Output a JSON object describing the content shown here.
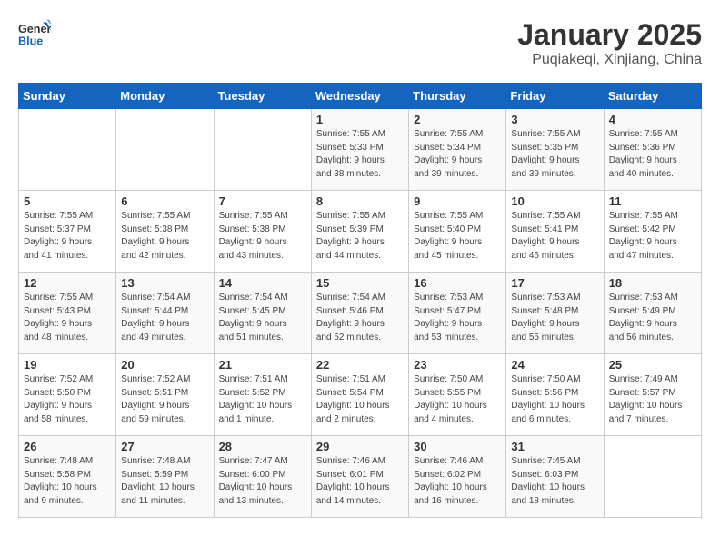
{
  "header": {
    "logo_line1": "General",
    "logo_line2": "Blue",
    "title": "January 2025",
    "subtitle": "Puqiakeqi, Xinjiang, China"
  },
  "days_of_week": [
    "Sunday",
    "Monday",
    "Tuesday",
    "Wednesday",
    "Thursday",
    "Friday",
    "Saturday"
  ],
  "weeks": [
    [
      {
        "day": "",
        "info": ""
      },
      {
        "day": "",
        "info": ""
      },
      {
        "day": "",
        "info": ""
      },
      {
        "day": "1",
        "info": "Sunrise: 7:55 AM\nSunset: 5:33 PM\nDaylight: 9 hours\nand 38 minutes."
      },
      {
        "day": "2",
        "info": "Sunrise: 7:55 AM\nSunset: 5:34 PM\nDaylight: 9 hours\nand 39 minutes."
      },
      {
        "day": "3",
        "info": "Sunrise: 7:55 AM\nSunset: 5:35 PM\nDaylight: 9 hours\nand 39 minutes."
      },
      {
        "day": "4",
        "info": "Sunrise: 7:55 AM\nSunset: 5:36 PM\nDaylight: 9 hours\nand 40 minutes."
      }
    ],
    [
      {
        "day": "5",
        "info": "Sunrise: 7:55 AM\nSunset: 5:37 PM\nDaylight: 9 hours\nand 41 minutes."
      },
      {
        "day": "6",
        "info": "Sunrise: 7:55 AM\nSunset: 5:38 PM\nDaylight: 9 hours\nand 42 minutes."
      },
      {
        "day": "7",
        "info": "Sunrise: 7:55 AM\nSunset: 5:38 PM\nDaylight: 9 hours\nand 43 minutes."
      },
      {
        "day": "8",
        "info": "Sunrise: 7:55 AM\nSunset: 5:39 PM\nDaylight: 9 hours\nand 44 minutes."
      },
      {
        "day": "9",
        "info": "Sunrise: 7:55 AM\nSunset: 5:40 PM\nDaylight: 9 hours\nand 45 minutes."
      },
      {
        "day": "10",
        "info": "Sunrise: 7:55 AM\nSunset: 5:41 PM\nDaylight: 9 hours\nand 46 minutes."
      },
      {
        "day": "11",
        "info": "Sunrise: 7:55 AM\nSunset: 5:42 PM\nDaylight: 9 hours\nand 47 minutes."
      }
    ],
    [
      {
        "day": "12",
        "info": "Sunrise: 7:55 AM\nSunset: 5:43 PM\nDaylight: 9 hours\nand 48 minutes."
      },
      {
        "day": "13",
        "info": "Sunrise: 7:54 AM\nSunset: 5:44 PM\nDaylight: 9 hours\nand 49 minutes."
      },
      {
        "day": "14",
        "info": "Sunrise: 7:54 AM\nSunset: 5:45 PM\nDaylight: 9 hours\nand 51 minutes."
      },
      {
        "day": "15",
        "info": "Sunrise: 7:54 AM\nSunset: 5:46 PM\nDaylight: 9 hours\nand 52 minutes."
      },
      {
        "day": "16",
        "info": "Sunrise: 7:53 AM\nSunset: 5:47 PM\nDaylight: 9 hours\nand 53 minutes."
      },
      {
        "day": "17",
        "info": "Sunrise: 7:53 AM\nSunset: 5:48 PM\nDaylight: 9 hours\nand 55 minutes."
      },
      {
        "day": "18",
        "info": "Sunrise: 7:53 AM\nSunset: 5:49 PM\nDaylight: 9 hours\nand 56 minutes."
      }
    ],
    [
      {
        "day": "19",
        "info": "Sunrise: 7:52 AM\nSunset: 5:50 PM\nDaylight: 9 hours\nand 58 minutes."
      },
      {
        "day": "20",
        "info": "Sunrise: 7:52 AM\nSunset: 5:51 PM\nDaylight: 9 hours\nand 59 minutes."
      },
      {
        "day": "21",
        "info": "Sunrise: 7:51 AM\nSunset: 5:52 PM\nDaylight: 10 hours\nand 1 minute."
      },
      {
        "day": "22",
        "info": "Sunrise: 7:51 AM\nSunset: 5:54 PM\nDaylight: 10 hours\nand 2 minutes."
      },
      {
        "day": "23",
        "info": "Sunrise: 7:50 AM\nSunset: 5:55 PM\nDaylight: 10 hours\nand 4 minutes."
      },
      {
        "day": "24",
        "info": "Sunrise: 7:50 AM\nSunset: 5:56 PM\nDaylight: 10 hours\nand 6 minutes."
      },
      {
        "day": "25",
        "info": "Sunrise: 7:49 AM\nSunset: 5:57 PM\nDaylight: 10 hours\nand 7 minutes."
      }
    ],
    [
      {
        "day": "26",
        "info": "Sunrise: 7:48 AM\nSunset: 5:58 PM\nDaylight: 10 hours\nand 9 minutes."
      },
      {
        "day": "27",
        "info": "Sunrise: 7:48 AM\nSunset: 5:59 PM\nDaylight: 10 hours\nand 11 minutes."
      },
      {
        "day": "28",
        "info": "Sunrise: 7:47 AM\nSunset: 6:00 PM\nDaylight: 10 hours\nand 13 minutes."
      },
      {
        "day": "29",
        "info": "Sunrise: 7:46 AM\nSunset: 6:01 PM\nDaylight: 10 hours\nand 14 minutes."
      },
      {
        "day": "30",
        "info": "Sunrise: 7:46 AM\nSunset: 6:02 PM\nDaylight: 10 hours\nand 16 minutes."
      },
      {
        "day": "31",
        "info": "Sunrise: 7:45 AM\nSunset: 6:03 PM\nDaylight: 10 hours\nand 18 minutes."
      },
      {
        "day": "",
        "info": ""
      }
    ]
  ]
}
